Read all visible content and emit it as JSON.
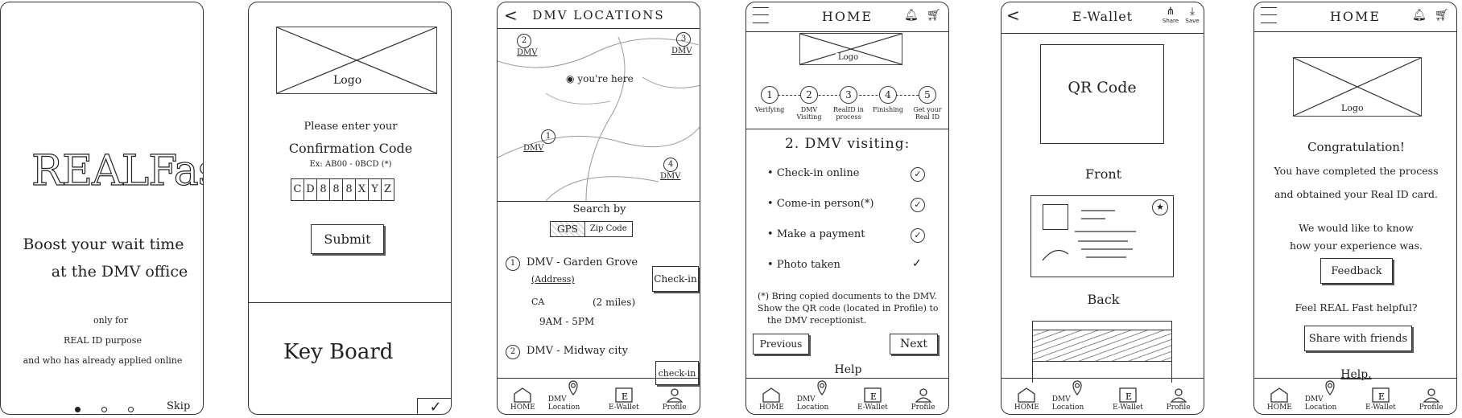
{
  "screen1": {
    "logo": "REALFast",
    "headline_1": "Boost your wait time",
    "headline_2": "at the DMV office",
    "note_1": "only for",
    "note_2": "REAL ID purpose",
    "note_3": "and who has already applied online",
    "skip": "Skip"
  },
  "screen2": {
    "logo_label": "Logo",
    "prompt_1": "Please enter your",
    "prompt_2": "Confirmation Code",
    "example": "Ex: AB00 - 0BCD (*)",
    "code": [
      "C",
      "D",
      "8",
      "8",
      "8",
      "X",
      "Y",
      "Z"
    ],
    "submit": "Submit",
    "keyboard": "Key Board",
    "check": "✓"
  },
  "screen3": {
    "title": "DMV LOCATIONS",
    "back": "<",
    "map_you": "you're here",
    "map_markers": [
      {
        "num": "2",
        "label": "DMV"
      },
      {
        "num": "3",
        "label": "DMV"
      },
      {
        "num": "1",
        "label": "DMV"
      },
      {
        "num": "4",
        "label": "DMV"
      }
    ],
    "search_by": "Search by",
    "search_opts": [
      "GPS",
      "Zip Code"
    ],
    "loc1": {
      "num": "1",
      "name": "DMV - Garden Grove",
      "address": "(Address)",
      "city": "CA",
      "distance": "(2 miles)",
      "hours": "9AM - 5PM",
      "checkin": "Check-in"
    },
    "loc2": {
      "num": "2",
      "name": "DMV - Midway city",
      "checkin": "check-in"
    }
  },
  "screen4": {
    "title": "HOME",
    "icon_labels": [
      "Profile",
      "Feedback",
      "Cart"
    ],
    "logo_label": "Logo",
    "steps": [
      {
        "num": "1",
        "label": "Verifying"
      },
      {
        "num": "2",
        "label": "DMV Visiting"
      },
      {
        "num": "3",
        "label": "RealID in process"
      },
      {
        "num": "4",
        "label": "Finishing"
      },
      {
        "num": "5",
        "label": "Get your Real ID"
      }
    ],
    "section_title": "2. DMV visiting:",
    "tasks": [
      "Check-in online",
      "Come-in person(*)",
      "Make a payment",
      "Photo taken"
    ],
    "note_1": "(*) Bring copied documents to the DMV.",
    "note_2": "Show the QR code (located in Profile) to",
    "note_3": "the DMV receptionist.",
    "prev": "Previous",
    "next": "Next",
    "help": "Help"
  },
  "screen5": {
    "title": "E-Wallet",
    "back": "<",
    "share": "Share",
    "save": "Save",
    "qr": "QR Code",
    "front": "Front",
    "back_label": "Back"
  },
  "screen6": {
    "title": "HOME",
    "logo_label": "Logo",
    "msg_1": "Congratulation!",
    "msg_2": "You have completed the process",
    "msg_3": "and obtained your Real ID card.",
    "msg_4": "We would like to know",
    "msg_5": "how your experience was.",
    "feedback": "Feedback",
    "msg_6": "Feel REAL Fast helpful?",
    "share": "Share with friends",
    "help": "Help."
  },
  "nav": [
    "HOME",
    "DMV Location",
    "E-Wallet",
    "Profile"
  ]
}
